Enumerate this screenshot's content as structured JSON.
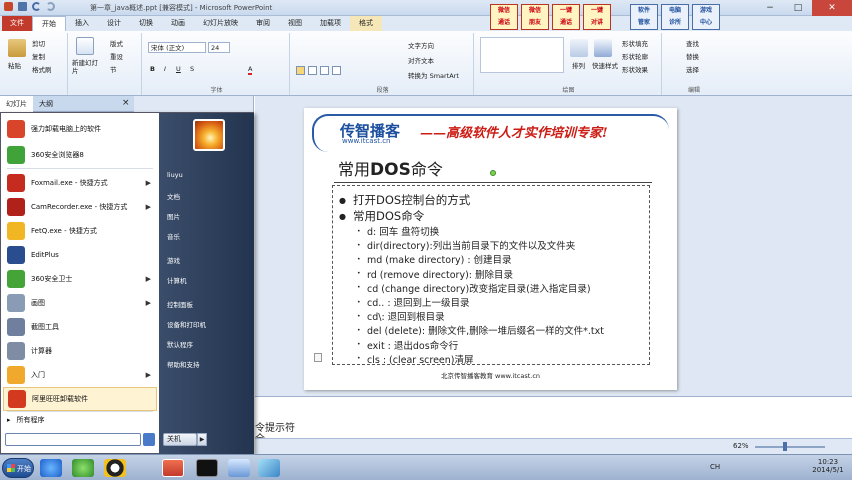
{
  "window": {
    "title": "第一章_java概述.ppt [兼容模式] - Microsoft PowerPoint",
    "min": "−",
    "max": "□",
    "close": "✕"
  },
  "ribbon_tabs": [
    {
      "label": "文件",
      "kind": "file"
    },
    {
      "label": "开始",
      "kind": "on"
    },
    {
      "label": "插入",
      "kind": ""
    },
    {
      "label": "设计",
      "kind": ""
    },
    {
      "label": "切换",
      "kind": ""
    },
    {
      "label": "动画",
      "kind": ""
    },
    {
      "label": "幻灯片放映",
      "kind": ""
    },
    {
      "label": "审阅",
      "kind": ""
    },
    {
      "label": "视图",
      "kind": ""
    },
    {
      "label": "加载项",
      "kind": ""
    },
    {
      "label": "格式",
      "kind": "fmt"
    }
  ],
  "ribbon": {
    "clipboard": {
      "paste": "粘贴",
      "cut": "剪切",
      "copy": "复制",
      "format_painter": "格式刷"
    },
    "slides": {
      "new_slide": "新建幻灯片",
      "layout": "版式",
      "reset": "重设",
      "section": "节"
    },
    "font": {
      "name": "宋体 (正文)",
      "size": "24",
      "label": "字体"
    },
    "paragraph": {
      "text_direction": "文字方向",
      "align_text": "对齐文本",
      "smartart": "转换为 SmartArt",
      "label": "段落"
    },
    "drawing": {
      "arrange": "排列",
      "quick_styles": "快速样式",
      "fill": "形状填充",
      "outline": "形状轮廓",
      "effects": "形状效果",
      "label": "绘图"
    },
    "editing": {
      "find": "查找",
      "replace": "替换",
      "select": "选择",
      "label": "编辑"
    },
    "ads": [
      "微信\n通话",
      "微信\n朋友",
      "一键\n通话",
      "一键\n对讲"
    ],
    "ads2": [
      "软件\n管家",
      "电脑\n诊所",
      "游戏\n中心"
    ]
  },
  "left_pane": {
    "tab_slides": "幻灯片",
    "tab_outline": "大纲",
    "close": "×"
  },
  "start_menu": {
    "items": [
      {
        "label": "强力卸载电脑上的软件",
        "color": "#d9452b",
        "arrow": ""
      },
      {
        "label": "360安全浏览器8",
        "color": "#3fa33a",
        "arrow": ""
      },
      {
        "label": "Foxmail.exe - 快捷方式",
        "color": "#c62b20",
        "arrow": "▶"
      },
      {
        "label": "CamRecorder.exe - 快捷方式",
        "color": "#b0211a",
        "arrow": "▶"
      },
      {
        "label": "FetQ.exe - 快捷方式",
        "color": "#f1b623",
        "arrow": ""
      },
      {
        "label": "EditPlus",
        "color": "#2a4d8f",
        "arrow": ""
      },
      {
        "label": "360安全卫士",
        "color": "#44a438",
        "arrow": "▶"
      },
      {
        "label": "画图",
        "color": "#8a9bb5",
        "arrow": "▶"
      },
      {
        "label": "截图工具",
        "color": "#6f7f9d",
        "arrow": ""
      },
      {
        "label": "计算器",
        "color": "#7e8ca4",
        "arrow": ""
      },
      {
        "label": "入门",
        "color": "#f0a82d",
        "arrow": "▶"
      },
      {
        "label": "阿里旺旺卸载软件",
        "color": "#d3391f",
        "arrow": ""
      }
    ],
    "all_programs": "所有程序",
    "search_placeholder": "",
    "right_links": [
      "liuyu",
      "文档",
      "图片",
      "音乐",
      "游戏",
      "计算机",
      "控制面板",
      "设备和打印机",
      "默认程序",
      "帮助和支持"
    ],
    "shutdown": "关机",
    "shutdown_arrow": "▶"
  },
  "slide": {
    "brand": "传智播客",
    "slogan": "——高级软件人才实作培训专家!",
    "url": "www.itcast.cn",
    "title_pre": "常用",
    "title_bold": "DOS",
    "title_post": "命令",
    "bullets": [
      "打开DOS控制台的方式",
      "常用DOS命令"
    ],
    "sub_bullets": [
      "d: 回车    盘符切换",
      "dir(directory):列出当前目录下的文件以及文件夹",
      "md (make directory) : 创建目录",
      "rd (remove directory): 删除目录",
      "cd (change directory)改变指定目录(进入指定目录)",
      "cd.. : 退回到上一级目录",
      "cd\\: 退回到根目录",
      "del (delete): 删除文件,删除一堆后缀名一样的文件*.txt",
      "exit : 退出dos命令行",
      "cls : (clear screen)清屏"
    ],
    "footer": "北京传智播客教育 www.itcast.cn"
  },
  "notes": {
    "line1": "令提示符",
    "line2": "全"
  },
  "status": {
    "zoom": "62%"
  },
  "taskbar": {
    "start": "开始",
    "tray": {
      "lang": "CH",
      "time": "10:23",
      "date": "2014/5/1"
    }
  }
}
